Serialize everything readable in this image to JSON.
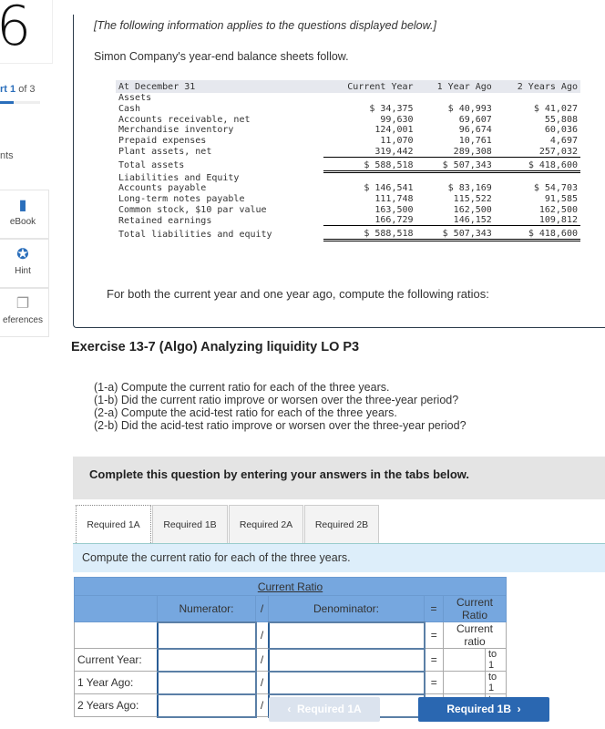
{
  "sidebar": {
    "question_number": "6",
    "part_label": "rt",
    "part_num": "1",
    "part_of": "of 3",
    "progress": 0.33,
    "points_label": "nts",
    "buttons": [
      {
        "label": "eBook",
        "icon": "book-icon"
      },
      {
        "label": "Hint",
        "icon": "lifebuoy-icon"
      },
      {
        "label": "eferences",
        "icon": "references-icon"
      }
    ]
  },
  "intro": "[The following information applies to the questions displayed below.]",
  "company_line": "Simon Company's year-end balance sheets follow.",
  "balance_sheet": {
    "headers": [
      "At December 31",
      "Current Year",
      "1 Year Ago",
      "2 Years Ago"
    ],
    "assets_label": "Assets",
    "assets": [
      [
        "Cash",
        "$ 34,375",
        "$ 40,993",
        "$ 41,027"
      ],
      [
        "Accounts receivable, net",
        "99,630",
        "69,607",
        "55,808"
      ],
      [
        "Merchandise inventory",
        "124,001",
        "96,674",
        "60,036"
      ],
      [
        "Prepaid expenses",
        "11,070",
        "10,761",
        "4,697"
      ],
      [
        "Plant assets, net",
        "319,442",
        "289,308",
        "257,032"
      ]
    ],
    "total_assets": [
      "Total assets",
      "$ 588,518",
      "$ 507,343",
      "$ 418,600"
    ],
    "liab_label": "Liabilities and Equity",
    "liabilities": [
      [
        "Accounts payable",
        "$ 146,541",
        "$ 83,169",
        "$ 54,703"
      ],
      [
        "Long-term notes payable",
        "111,748",
        "115,522",
        "91,585"
      ],
      [
        "Common stock, $10 par value",
        "163,500",
        "162,500",
        "162,500"
      ],
      [
        "Retained earnings",
        "166,729",
        "146,152",
        "109,812"
      ]
    ],
    "total_liab": [
      "Total liabilities and equity",
      "$ 588,518",
      "$ 507,343",
      "$ 418,600"
    ]
  },
  "for_both": "For both the current year and one year ago, compute the following ratios:",
  "exercise_title": "Exercise 13-7 (Algo) Analyzing liquidity LO P3",
  "questions": [
    "(1-a) Compute the current ratio for each of the three years.",
    "(1-b) Did the current ratio improve or worsen over the three-year period?",
    "(2-a) Compute the acid-test ratio for each of the three years.",
    "(2-b) Did the acid-test ratio improve or worsen over the three-year period?"
  ],
  "complete_band": "Complete this question by entering your answers in the tabs below.",
  "tabs": [
    "Required 1A",
    "Required 1B",
    "Required 2A",
    "Required 2B"
  ],
  "instruction": "Compute the current ratio for each of the three years.",
  "ratio_table": {
    "title": "Current Ratio",
    "numerator": "Numerator:",
    "slash": "/",
    "denominator": "Denominator:",
    "equals": "=",
    "result": "Current Ratio",
    "sub_result": "Current ratio",
    "rows": [
      "Current Year:",
      "1 Year Ago:",
      "2 Years Ago:"
    ],
    "to1": "to 1"
  },
  "nav": {
    "prev": "Required 1A",
    "next": "Required 1B"
  },
  "colors": {
    "accent": "#2a67b1",
    "table_header": "#76a7df",
    "instruction_bg": "#ddeefa"
  }
}
